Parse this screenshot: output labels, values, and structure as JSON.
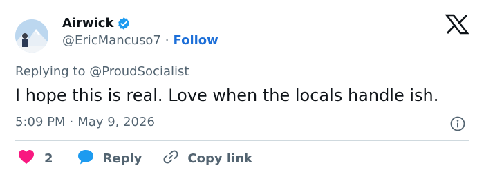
{
  "user": {
    "display_name": "Airwick",
    "handle": "@EricMancuso7",
    "separator": "·",
    "follow_label": "Follow",
    "avatar_icon": "avatar-mountain-photo",
    "verified_icon": "verified-badge-icon"
  },
  "reply": {
    "prefix": "Replying to",
    "handle": "@ProudSocialist"
  },
  "tweet": {
    "text": "I hope this is real. Love when the locals handle ish.",
    "time": "5:09 PM",
    "separator": "·",
    "date": "May 9, 2026"
  },
  "actions": {
    "like_count": "2",
    "reply_label": "Reply",
    "copy_label": "Copy link"
  },
  "colors": {
    "accent_blue": "#1d9bf0",
    "like_pink": "#f91880",
    "text_secondary": "#536471"
  }
}
